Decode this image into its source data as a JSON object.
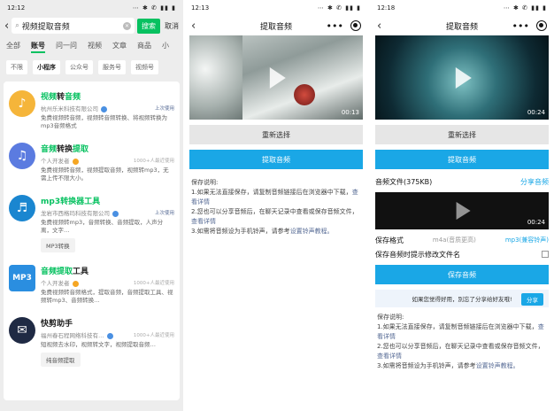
{
  "panel1": {
    "time": "12:12",
    "status_icons": "⋯ ✱ ✆ ▮▮ ▮",
    "search": {
      "query": "视频提取音频",
      "button": "搜索",
      "cancel": "取消"
    },
    "tabs": [
      "全部",
      "账号",
      "问一问",
      "视频",
      "文章",
      "商品",
      "小"
    ],
    "active_tab": "账号",
    "filters": [
      "不限",
      "小程序",
      "公众号",
      "服务号",
      "视频号"
    ],
    "active_filter": "小程序",
    "results": [
      {
        "title_hl": "视频",
        "title_rest": "转",
        "title_hl2": "音频",
        "sub": "杭州乐米科技有限公司",
        "badge": "上次使用",
        "desc": "免费视频转音频，视频转音频转换、将视频转换为mp3音频格式",
        "logo_color": "#f5b53a",
        "logo_glyph": "♪"
      },
      {
        "title_hl": "音频",
        "title_rest": "转换",
        "title_hl2": "提取",
        "sub": "个人开发者",
        "badge": "1000+人最近使用",
        "desc": "免费视频转音频，视频提取音频，视频转mp3，无需上传不限大小。",
        "logo_color": "#5b7be0",
        "logo_glyph": "♫"
      },
      {
        "title_hl": "mp3转换器工具",
        "title_rest": "",
        "title_hl2": "",
        "sub": "龙岩市西格玛科技有限公司",
        "badge": "上次使用",
        "desc": "免费视频转mp3，音频转换、音频提取，人声分离，文字…",
        "logo_color": "#1a86d0",
        "logo_glyph": "♬",
        "sub_button": "MP3转换"
      },
      {
        "title_hl": "音频提取",
        "title_rest": "工具",
        "title_hl2": "",
        "sub": "个人开发者",
        "badge": "1000+人最近使用",
        "desc": "免费视频转音频格式，提取音频，音频提取工具、视频转mp3、音频转换…",
        "logo_color": "#2a8ee0",
        "logo_glyph": "MP3"
      },
      {
        "title_hl": "快剪助手",
        "title_rest": "",
        "title_hl2": "",
        "sub": "福州春石程网络科技有…",
        "badge": "1000+人最近使用",
        "desc": "短视频去水印，视频转文字，视频提取音频…",
        "logo_color": "#1f2a44",
        "logo_glyph": "✉",
        "sub_button": "纯音频提取"
      }
    ]
  },
  "panel2": {
    "time": "12:13",
    "title": "提取音频",
    "duration": "00:13",
    "reselect": "重新选择",
    "extract": "提取音频",
    "notes_title": "保存说明:",
    "note1": "1.如果无法直接保存，请复制音频链接后在浏览器中下载，",
    "note1_link": "查看详情",
    "note2": "2.您也可以分享音频后，在聊天记录中查看或保存音频文件，",
    "note2_link": "查看详情",
    "note3": "3.如需将音频设为手机铃声，请参考",
    "note3_link": "设置铃声教程。"
  },
  "panel3": {
    "time": "12:18",
    "title": "提取音频",
    "duration": "00:24",
    "reselect": "重新选择",
    "extract": "提取音频",
    "audio_label": "音频文件(375KB)",
    "share_audio": "分享音频",
    "audio_duration": "00:24",
    "format_label": "保存格式",
    "format_m4a": "m4a(音质更高)",
    "format_mp3": "mp3(兼容铃声)",
    "rename_label": "保存音频时提示修改文件名",
    "save_audio": "保存音频",
    "share_prompt": "如果您觉得好用，別忘了分享给好友哦!",
    "share_btn": "分享",
    "notes_title": "保存说明:",
    "note1": "1.如果无法直接保存，请复制音频链接后在浏览器中下载，",
    "note1_link": "查看详情",
    "note2": "2.您也可以分享音频后，在聊天记录中查看或保存音频文件，",
    "note2_link": "查看详情",
    "note3": "3.如需将音频设为手机铃声，请参考",
    "note3_link": "设置铃声教程。"
  }
}
